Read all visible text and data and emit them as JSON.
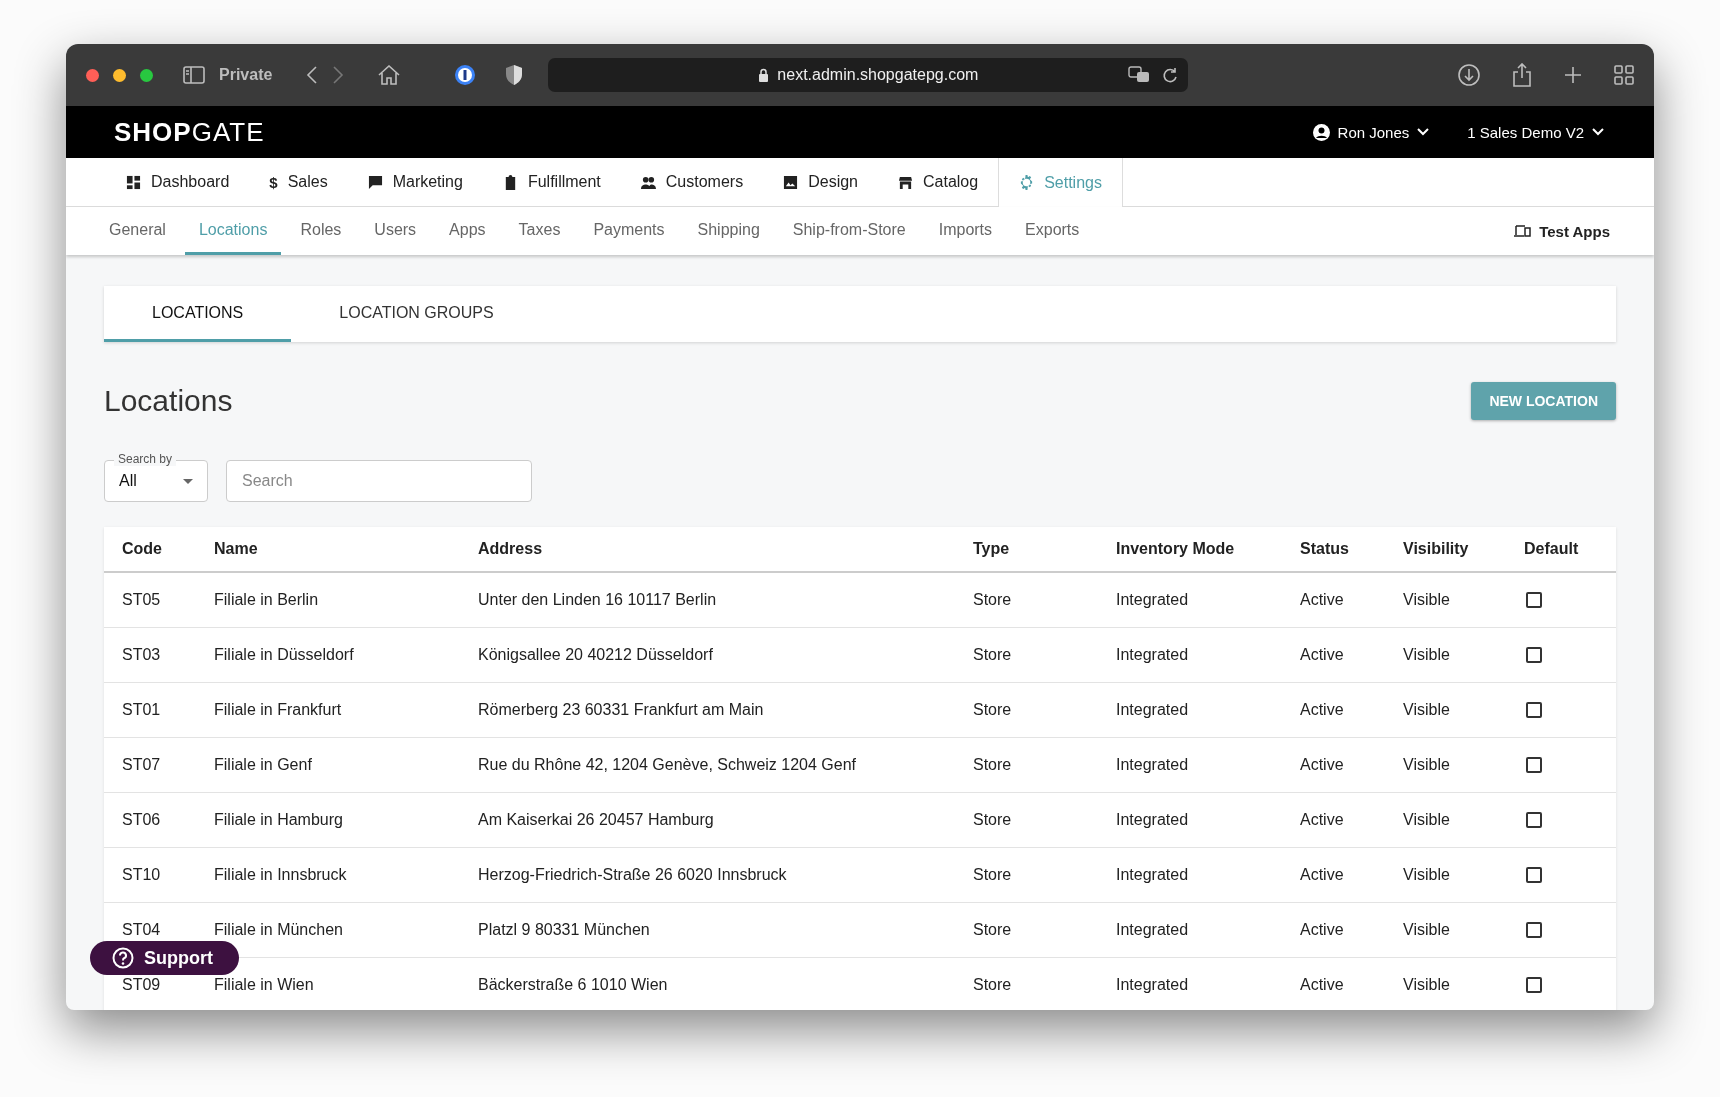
{
  "browser": {
    "private_label": "Private",
    "url": "next.admin.shopgatepg.com"
  },
  "header": {
    "logo": "**SHOP**GATE",
    "user": "Ron Jones",
    "shop": "1 Sales Demo V2"
  },
  "main_nav": [
    {
      "label": "Dashboard",
      "selected": false
    },
    {
      "label": "Sales",
      "selected": false,
      "glyph": "$"
    },
    {
      "label": "Marketing",
      "selected": false
    },
    {
      "label": "Fulfillment",
      "selected": false
    },
    {
      "label": "Customers",
      "selected": false
    },
    {
      "label": "Design",
      "selected": false
    },
    {
      "label": "Catalog",
      "selected": false
    },
    {
      "label": "Settings",
      "selected": true
    }
  ],
  "sub_nav": [
    {
      "label": "General",
      "selected": false
    },
    {
      "label": "Locations",
      "selected": true
    },
    {
      "label": "Roles",
      "selected": false
    },
    {
      "label": "Users",
      "selected": false
    },
    {
      "label": "Apps",
      "selected": false
    },
    {
      "label": "Taxes",
      "selected": false
    },
    {
      "label": "Payments",
      "selected": false
    },
    {
      "label": "Shipping",
      "selected": false
    },
    {
      "label": "Ship-from-Store",
      "selected": false
    },
    {
      "label": "Imports",
      "selected": false
    },
    {
      "label": "Exports",
      "selected": false
    }
  ],
  "test_apps": "Test Apps",
  "tabs": [
    {
      "label": "LOCATIONS",
      "selected": true
    },
    {
      "label": "LOCATION GROUPS",
      "selected": false
    }
  ],
  "page_title": "Locations",
  "new_button": "NEW LOCATION",
  "search_by": {
    "label": "Search by",
    "value": "All"
  },
  "search": {
    "placeholder": "Search"
  },
  "table": {
    "columns": [
      "Code",
      "Name",
      "Address",
      "Type",
      "Inventory Mode",
      "Status",
      "Visibility",
      "Default"
    ],
    "rows": [
      {
        "cells": [
          "ST05",
          "Filiale in Berlin",
          "Unter den Linden 16 10117 Berlin",
          "Store",
          "Integrated",
          "Active",
          "Visible"
        ],
        "checked": false
      },
      {
        "cells": [
          "ST03",
          "Filiale in Düsseldorf",
          "Königsallee 20 40212 Düsseldorf",
          "Store",
          "Integrated",
          "Active",
          "Visible"
        ],
        "checked": false
      },
      {
        "cells": [
          "ST01",
          "Filiale in Frankfurt",
          "Römerberg 23 60331 Frankfurt am Main",
          "Store",
          "Integrated",
          "Active",
          "Visible"
        ],
        "checked": false
      },
      {
        "cells": [
          "ST07",
          "Filiale in Genf",
          "Rue du Rhône 42, 1204 Genève, Schweiz 1204 Genf",
          "Store",
          "Integrated",
          "Active",
          "Visible"
        ],
        "checked": false
      },
      {
        "cells": [
          "ST06",
          "Filiale in Hamburg",
          "Am Kaiserkai 26 20457 Hamburg",
          "Store",
          "Integrated",
          "Active",
          "Visible"
        ],
        "checked": false
      },
      {
        "cells": [
          "ST10",
          "Filiale in Innsbruck",
          "Herzog-Friedrich-Straße 26 6020 Innsbruck",
          "Store",
          "Integrated",
          "Active",
          "Visible"
        ],
        "checked": false
      },
      {
        "cells": [
          "ST04",
          "Filiale in München",
          "Platzl 9 80331 München",
          "Store",
          "Integrated",
          "Active",
          "Visible"
        ],
        "checked": false
      },
      {
        "cells": [
          "ST09",
          "Filiale in Wien",
          "Bäckerstraße 6 1010 Wien",
          "Store",
          "Integrated",
          "Active",
          "Visible"
        ],
        "checked": false
      }
    ]
  },
  "support_button": "Support"
}
